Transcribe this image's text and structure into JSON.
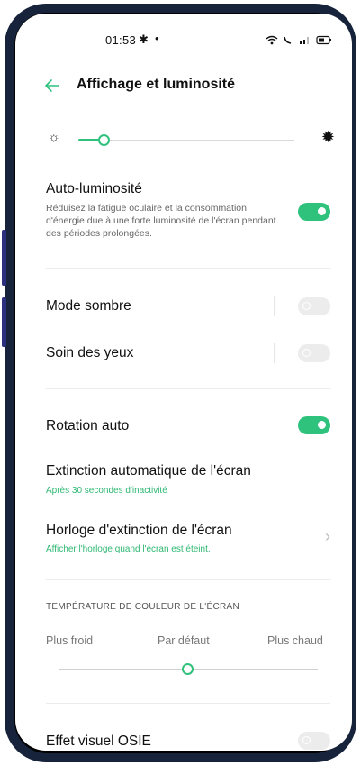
{
  "status_bar": {
    "time": "01:53",
    "settings_icon": "gear-icon",
    "notif_dot": "•",
    "indicators": "wifi signal battery"
  },
  "header": {
    "title": "Affichage et luminosité",
    "back_icon": "back-arrow-icon"
  },
  "brightness": {
    "level": 0.11,
    "accent": "#2fc27d"
  },
  "auto_brightness": {
    "title": "Auto-luminosité",
    "description": "Réduisez la fatigue oculaire et la consommation d'énergie due à une forte luminosité de l'écran pendant des périodes prolongées.",
    "enabled": true
  },
  "dark_mode": {
    "title": "Mode sombre",
    "enabled": false
  },
  "eye_care": {
    "title": "Soin des yeux",
    "enabled": false
  },
  "auto_rotate": {
    "title": "Rotation auto",
    "enabled": true
  },
  "screen_timeout": {
    "title": "Extinction automatique de l'écran",
    "value": "Après 30 secondes d'inactivité"
  },
  "screen_off_clock": {
    "title": "Horloge d'extinction de l'écran",
    "value": "Afficher l'horloge quand l'écran est éteint."
  },
  "color_temp": {
    "header": "TEMPÉRATURE DE COULEUR DE L'ÉCRAN",
    "cooler": "Plus froid",
    "default": "Par défaut",
    "warmer": "Plus chaud",
    "level": 0.5
  },
  "osie": {
    "title": "Effet visuel OSIE",
    "enabled": false
  }
}
